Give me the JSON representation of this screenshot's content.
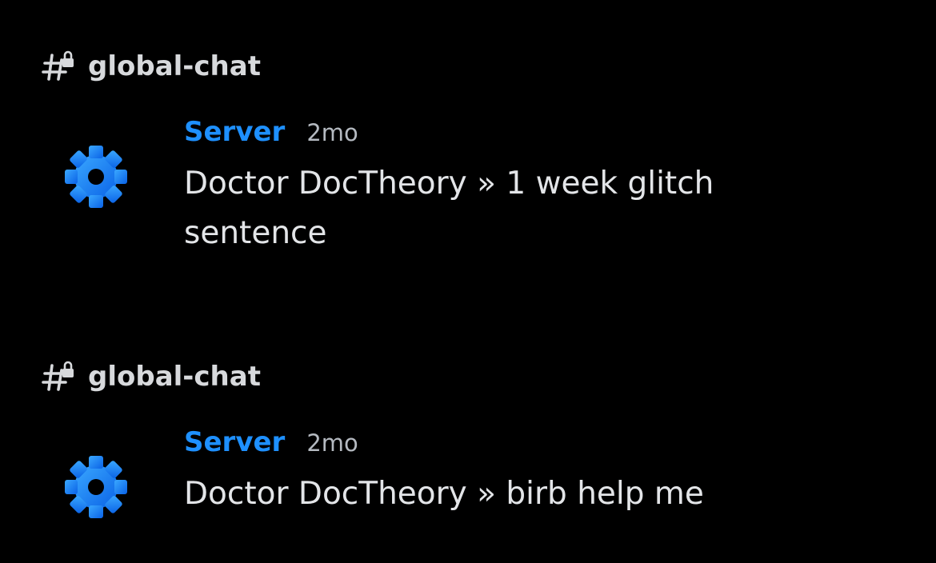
{
  "messages": [
    {
      "channel": "global-chat",
      "channel_icon": "hash-lock-icon",
      "author": "Server",
      "author_color": "#1e90ff",
      "avatar_icon": "gear-icon",
      "timestamp": "2mo",
      "text": "Doctor DocTheory » 1 week glitch sentence"
    },
    {
      "channel": "global-chat",
      "channel_icon": "hash-lock-icon",
      "author": "Server",
      "author_color": "#1e90ff",
      "avatar_icon": "gear-icon",
      "timestamp": "2mo",
      "text": "Doctor DocTheory » birb help me"
    }
  ],
  "colors": {
    "background": "#000000",
    "author": "#1e90ff",
    "text": "#e3e5e8",
    "muted": "#b5bac1"
  }
}
